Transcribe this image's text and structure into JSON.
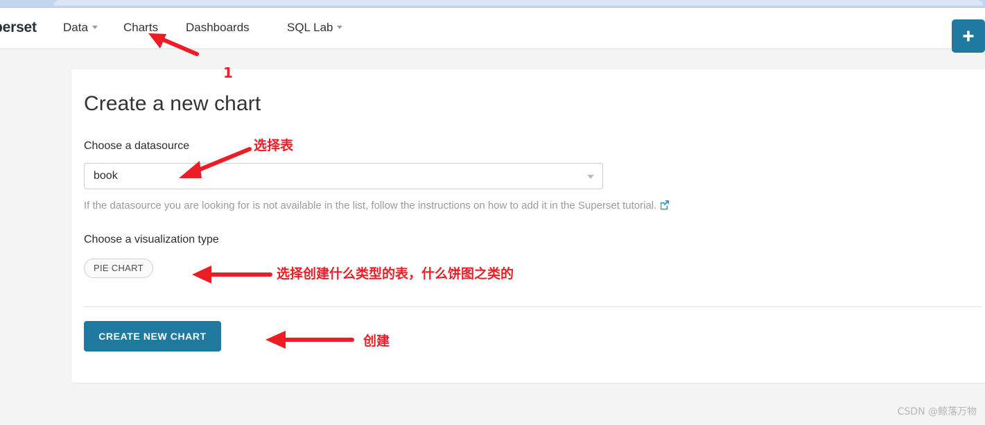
{
  "browser": {
    "chrome_strip_color": "#c3d5ef"
  },
  "navbar": {
    "brand": "perset",
    "items": [
      {
        "label": "Data",
        "has_dropdown": true
      },
      {
        "label": "Charts",
        "has_dropdown": false
      },
      {
        "label": "Dashboards",
        "has_dropdown": false
      },
      {
        "label": "SQL Lab",
        "has_dropdown": true
      }
    ],
    "new_button": {
      "icon": "plus-icon",
      "glyph": "➕",
      "color": "#20799e"
    }
  },
  "card": {
    "title": "Create a new chart",
    "datasource": {
      "label": "Choose a datasource",
      "value": "book",
      "placeholder": "Choose a datasource",
      "help_text": "If the datasource you are looking for is not available in the list, follow the instructions on how to add it in the Superset tutorial.",
      "help_link_icon": "external-link-icon",
      "help_link_color": "#2a87a8"
    },
    "visualization": {
      "label": "Choose a visualization type",
      "selected": "PIE CHART"
    },
    "submit_button": {
      "label": "CREATE NEW CHART",
      "color": "#20799e"
    }
  },
  "annotations": {
    "color": "#ee1c25",
    "items": [
      {
        "text": "1",
        "target": "charts-nav-item"
      },
      {
        "text": "选择表",
        "target": "datasource-select"
      },
      {
        "text": "选择创建什么类型的表，什么饼图之类的",
        "target": "viztype-pill"
      },
      {
        "text": "创建",
        "target": "create-chart-button"
      }
    ]
  },
  "watermark": {
    "text": "CSDN @鲸落万物"
  }
}
